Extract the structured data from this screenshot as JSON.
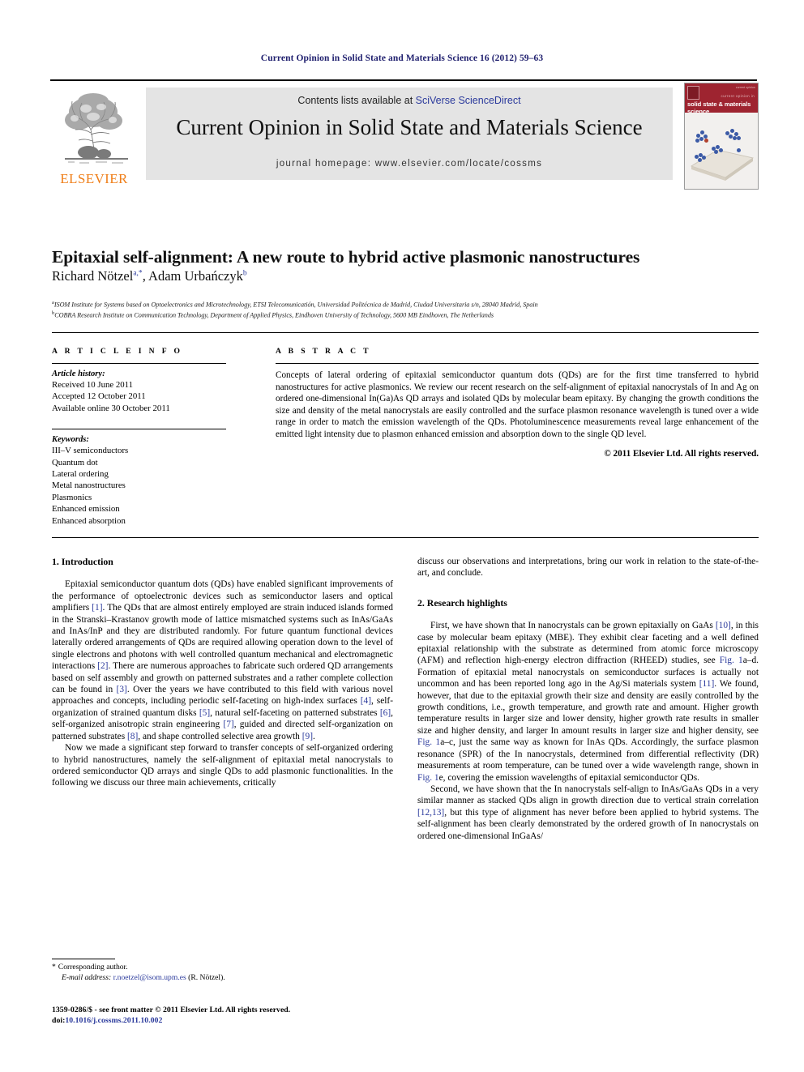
{
  "running_head": "Current Opinion in Solid State and Materials Science 16 (2012) 59–63",
  "banner": {
    "contents_prefix": "Contents lists available at ",
    "contents_link": "SciVerse ScienceDirect",
    "journal_title": "Current Opinion in Solid State and Materials Science",
    "homepage": "journal homepage: www.elsevier.com/locate/cossms",
    "publisher_wordmark": "ELSEVIER",
    "cover": {
      "top_micro": "current opinion",
      "kicker": "current opinion in",
      "name": "solid state & materials science"
    }
  },
  "article": {
    "title": "Epitaxial self-alignment: A new route to hybrid active plasmonic nanostructures",
    "authors": [
      {
        "name": "Richard Nötzel",
        "marks": "a,*"
      },
      {
        "name": "Adam Urbańczyk",
        "marks": "b"
      }
    ],
    "authors_separator": ", ",
    "affiliations": [
      {
        "mark": "a",
        "text": "ISOM Institute for Systems based on Optoelectronics and Microtechnology, ETSI Telecomunicatión, Universidad Politécnica de Madrid, Ciudad Universitaria s/n, 28040 Madrid, Spain"
      },
      {
        "mark": "b",
        "text": "COBRA Research Institute on Communication Technology, Department of Applied Physics, Eindhoven University of Technology, 5600 MB Eindhoven, The Netherlands"
      }
    ]
  },
  "article_info": {
    "heading": "A R T I C L E   I N F O",
    "history_label": "Article history:",
    "history": [
      "Received 10 June 2011",
      "Accepted 12 October 2011",
      "Available online 30 October 2011"
    ],
    "keywords_label": "Keywords:",
    "keywords": [
      "III–V semiconductors",
      "Quantum dot",
      "Lateral ordering",
      "Metal nanostructures",
      "Plasmonics",
      "Enhanced emission",
      "Enhanced absorption"
    ]
  },
  "abstract": {
    "heading": "A B S T R A C T",
    "text": "Concepts of lateral ordering of epitaxial semiconductor quantum dots (QDs) are for the first time transferred to hybrid nanostructures for active plasmonics. We review our recent research on the self-alignment of epitaxial nanocrystals of In and Ag on ordered one-dimensional In(Ga)As QD arrays and isolated QDs by molecular beam epitaxy. By changing the growth conditions the size and density of the metal nanocrystals are easily controlled and the surface plasmon resonance wavelength is tuned over a wide range in order to match the emission wavelength of the QDs. Photoluminescence measurements reveal large enhancement of the emitted light intensity due to plasmon enhanced emission and absorption down to the single QD level.",
    "copyright": "© 2011 Elsevier Ltd. All rights reserved."
  },
  "body": {
    "left_column": {
      "section_heading": "1. Introduction",
      "paragraph_1_a": "Epitaxial semiconductor quantum dots (QDs) have enabled significant improvements of the performance of optoelectronic devices such as semiconductor lasers and optical amplifiers ",
      "ref_1": "[1]",
      "paragraph_1_b": ". The QDs that are almost entirely employed are strain induced islands formed in the Stranski–Krastanov growth mode of lattice mismatched systems such as InAs/GaAs and InAs/InP and they are distributed randomly. For future quantum functional devices laterally ordered arrangements of QDs are required allowing operation down to the level of single electrons and photons with well controlled quantum mechanical and electromagnetic interactions ",
      "ref_2": "[2]",
      "paragraph_1_c": ". There are numerous approaches to fabricate such ordered QD arrangements based on self assembly and growth on patterned substrates and a rather complete collection can be found in ",
      "ref_3": "[3]",
      "paragraph_1_d": ". Over the years we have contributed to this field with various novel approaches and concepts, including periodic self-faceting on high-index surfaces ",
      "ref_4": "[4]",
      "paragraph_1_e": ", self-organization of strained quantum disks ",
      "ref_5": "[5]",
      "paragraph_1_f": ", natural self-faceting on patterned substrates ",
      "ref_6": "[6]",
      "paragraph_1_g": ", self-organized anisotropic strain engineering ",
      "ref_7": "[7]",
      "paragraph_1_h": ", guided and directed self-organization on patterned substrates ",
      "ref_8": "[8]",
      "paragraph_1_i": ", and shape controlled selective area growth ",
      "ref_9": "[9]",
      "paragraph_1_j": ".",
      "paragraph_2": "Now we made a significant step forward to transfer concepts of self-organized ordering to hybrid nanostructures, namely the self-alignment of epitaxial metal nanocrystals to ordered semiconductor QD arrays and single QDs to add plasmonic functionalities. In the following we discuss our three main achievements, critically"
    },
    "right_column": {
      "continuation": "discuss our observations and interpretations, bring our work in relation to the state-of-the-art, and conclude.",
      "section_heading": "2. Research highlights",
      "paragraph_1_a": "First, we have shown that In nanocrystals can be grown epitaxially on GaAs ",
      "ref_10": "[10]",
      "paragraph_1_b": ", in this case by molecular beam epitaxy (MBE). They exhibit clear faceting and a well defined epitaxial relationship with the substrate as determined from atomic force microscopy (AFM) and reflection high-energy electron diffraction (RHEED) studies, see ",
      "fig_ref_1": "Fig. 1",
      "paragraph_1_c": "a–d. Formation of epitaxial metal nanocrystals on semiconductor surfaces is actually not uncommon and has been reported long ago in the Ag/Si materials system ",
      "ref_11": "[11]",
      "paragraph_1_d": ". We found, however, that due to the epitaxial growth their size and density are easily controlled by the growth conditions, i.e., growth temperature, and growth rate and amount. Higher growth temperature results in larger size and lower density, higher growth rate results in smaller size and higher density, and larger In amount results in larger size and higher density, see ",
      "fig_ref_2": "Fig. 1",
      "paragraph_1_e": "a–c, just the same way as known for InAs QDs. Accordingly, the surface plasmon resonance (SPR) of the In nanocrystals, determined from differential reflectivity (DR) measurements at room temperature, can be tuned over a wide wavelength range, shown in ",
      "fig_ref_3": "Fig. 1",
      "paragraph_1_f": "e, covering the emission wavelengths of epitaxial semiconductor QDs.",
      "paragraph_2_a": "Second, we have shown that the In nanocrystals self-align to InAs/GaAs QDs in a very similar manner as stacked QDs align in growth direction due to vertical strain correlation ",
      "ref_12": "[12,13]",
      "paragraph_2_b": ", but this type of alignment has never before been applied to hybrid systems. The self-alignment has been clearly demonstrated by the ordered growth of In nanocrystals on ordered one-dimensional InGaAs/"
    }
  },
  "footnote": {
    "corresponding_star": "*",
    "corresponding_label": "Corresponding author.",
    "email_label": "E-mail address:",
    "email": "r.noetzel@isom.upm.es",
    "email_owner": "(R. Nötzel)."
  },
  "footer": {
    "issn_line": "1359-0286/$ - see front matter © 2011 Elsevier Ltd. All rights reserved.",
    "doi_label": "doi:",
    "doi": "10.1016/j.cossms.2011.10.002"
  },
  "colors": {
    "link_blue": "#2b3a9c",
    "header_navy": "#1f1f6e",
    "elsevier_orange": "#ef7f1a",
    "cover_red": "#9e2430",
    "panel_gray": "#e4e4e4"
  }
}
